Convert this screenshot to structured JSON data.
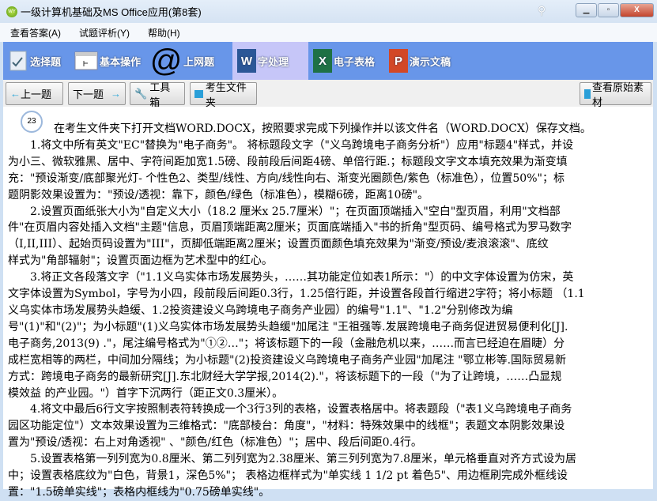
{
  "window": {
    "title": "一级计算机基础及MS Office应用(第8套)",
    "logo_text": "WY",
    "minimize": "▁",
    "maximize": "▫",
    "close": "X"
  },
  "menu": [
    "查看答案(A)",
    "试题评析(Y)",
    "帮助(H)"
  ],
  "tabs": [
    {
      "label": "选择题",
      "icon": "checklist-icon"
    },
    {
      "label": "基本操作",
      "icon": "window-icon"
    },
    {
      "label": "上网题",
      "icon": "at-icon"
    },
    {
      "label": "字处理",
      "icon": "word-icon",
      "active": true
    },
    {
      "label": "电子表格",
      "icon": "excel-icon"
    },
    {
      "label": "演示文稿",
      "icon": "powerpoint-icon"
    }
  ],
  "tab_glyphs": {
    "at": "@",
    "word": "W",
    "excel": "X",
    "ppt": "P"
  },
  "toolbar": {
    "prev": "上一题",
    "next": "下一题",
    "tools": "工具箱",
    "folder": "考生文件夹",
    "view_source": "查看原始素材",
    "prev_arrow": "←",
    "next_arrow": "→"
  },
  "question": {
    "number": "23",
    "lines": [
      "在考生文件夹下打开文档WORD.DOCX，按照要求完成下列操作并以该文件名（WORD.DOCX）保存文档。",
      "1.将文中所有英文\"EC\"替换为\"电子商务\"。 将标题段文字（\"义乌跨境电子商务分析\"）应用\"标题4\"样式，并设",
      "为小三、微软雅黑、居中、字符间距加宽1.5磅、段前段后间距4磅、单倍行距.；标题段文字文本填充效果为渐变填",
      "充：\"预设渐变/底部聚光灯- 个性色2、类型/线性、方向/线性向右、渐变光圈颜色/紫色（标准色），位置50%\"；标",
      "题阴影效果设置为：\"预设/透视：靠下，颜色/绿色（标准色），模糊6磅，距离10磅\"。",
      "2.设置页面纸张大小为\"自定义大小（18.2 厘米x 25.7厘米）\"；在页面顶端插入\"空白\"型页眉，利用\"文档部",
      "件\"在页眉内容处插入文档\"主题\"信息，页眉顶端距离2厘米；页面底端插入\"书的折角\"型页码、编号格式为罗马数字",
      "（I,II,III）、起始页码设置为\"III\"，页脚低端距离2厘米；设置页面颜色填充效果为\"渐变/预设/麦浪滚滚\"、底纹",
      "样式为\"角部辐射\"；设置页面边框为艺术型中的红心。",
      "3.将正文各段落文字（\"1.1义乌实体市场发展势头，……其功能定位如表1所示：\"）的中文字体设置为仿宋，英",
      "文字体设置为Symbol，字号为小四，段前段后间距0.3行，1.25倍行距，并设置各段首行缩进2字符；将小标题 （1.1",
      "义乌实体市场发展势头趋缓、1.2投资建设义乌跨境电子商务产业园）的编号\"1.1\"、\"1.2\"分别修改为编",
      "号\"(1)\"和\"(2)\"；为小标题\"(1)义乌实体市场发展势头趋缓\"加尾注 \"王祖强等.发展跨境电子商务促进贸易便利化[J].",
      "电子商务,2013(9) .\"，尾注编号格式为\"①②…\"；将该标题下的一段（金融危机以来，……而言已经迫在眉睫）分",
      "成栏宽相等的两栏，中间加分隔线；为小标题\"(2)投资建设义乌跨境电子商务产业园\"加尾注 \"鄂立彬等.国际贸易新",
      "方式：跨境电子商务的最新研究[J].东北财经大学学报,2014(2).\"，将该标题下的一段（\"为了让跨境，……凸显规",
      "模效益 的产业园。\"）首字下沉两行（距正文0.3厘米）。",
      "4.将文中最后6行文字按照制表符转换成一个3行3列的表格，设置表格居中。将表题段（\"表1义乌跨境电子商务",
      "园区功能定位\"）文本效果设置为三维格式：\"底部棱台：角度\"，\"材料：特殊效果中的线框\"；表题文本阴影效果设",
      "置为\"预设/透视：右上对角透视\" 、\"颜色/红色（标准色）\"；居中、段后间距0.4行。",
      "5.设置表格第一列列宽为0.8厘米、第二列列宽为2.38厘米、第三列列宽为7.8厘米，单元格垂直对齐方式设为居",
      "中；设置表格底纹为\"白色，背景1，深色5%\"； 表格边框样式为\"单实线 1 1/2 pt 着色5\"、用边框刷完成外框线设",
      "置：\"1.5磅单实线\"；表格内框线为\"0.75磅单实线\"。"
    ]
  }
}
